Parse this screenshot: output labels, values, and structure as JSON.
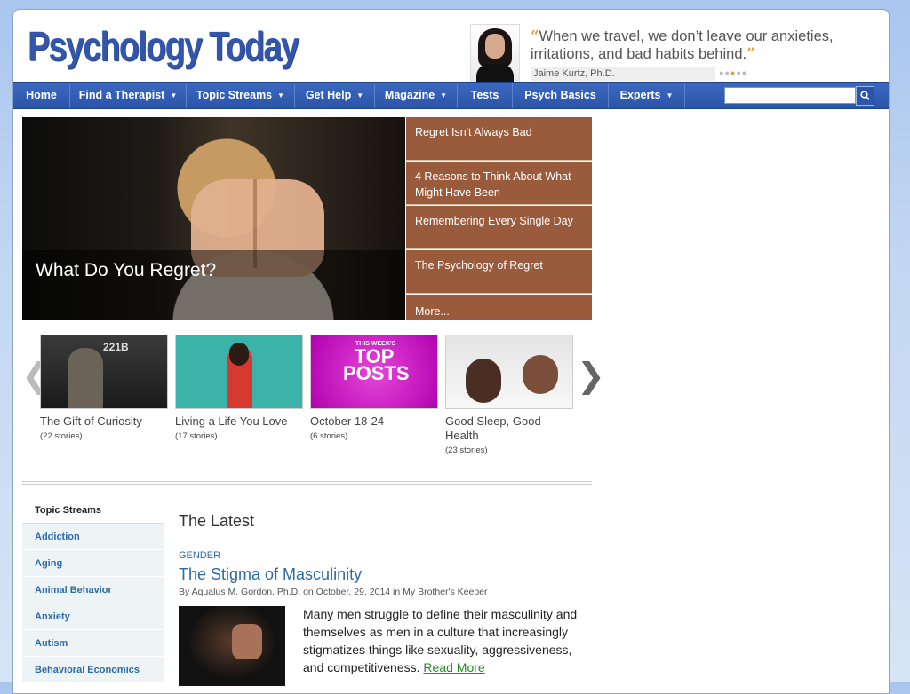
{
  "header": {
    "logo_text": "Psychology Today",
    "quote_text": "When we travel, we don’t leave our anxieties, irritations, and bad habits behind.",
    "quote_open": "“",
    "quote_close": "”",
    "quote_author": "Jaime Kurtz, Ph.D."
  },
  "nav": {
    "items": [
      {
        "label": "Home"
      },
      {
        "label": "Find a Therapist"
      },
      {
        "label": "Topic Streams"
      },
      {
        "label": "Get Help"
      },
      {
        "label": "Magazine"
      },
      {
        "label": "Tests"
      },
      {
        "label": "Psych Basics"
      },
      {
        "label": "Experts"
      }
    ],
    "search_placeholder": "",
    "caret": "▼",
    "search_icon": "search-icon"
  },
  "hero": {
    "title": "What Do You Regret?",
    "links": [
      {
        "label": "Regret Isn't Always Bad"
      },
      {
        "label": "4 Reasons to Think About What Might Have Been"
      },
      {
        "label": "Remembering Every Single Day"
      },
      {
        "label": "The Psychology of Regret"
      },
      {
        "label": "More..."
      }
    ]
  },
  "carousel": {
    "prev": "❮",
    "next": "❯",
    "cards": [
      {
        "title": "The Gift of Curiosity",
        "count": "(22 stories)",
        "thumb_text": "221B"
      },
      {
        "title": "Living a Life You Love",
        "count": "(17 stories)"
      },
      {
        "title": "October 18-24",
        "count": "(6 stories)",
        "thumb_small": "THIS WEEK'S",
        "thumb_big": "TOP POSTS"
      },
      {
        "title": "Good Sleep, Good Health",
        "count": "(23 stories)"
      }
    ]
  },
  "sidebar": {
    "heading": "Topic Streams",
    "items": [
      {
        "label": "Addiction"
      },
      {
        "label": "Aging"
      },
      {
        "label": "Animal Behavior"
      },
      {
        "label": "Anxiety"
      },
      {
        "label": "Autism"
      },
      {
        "label": "Behavioral Economics"
      }
    ]
  },
  "latest": {
    "heading": "The Latest",
    "category": "GENDER",
    "title": "The Stigma of Masculinity",
    "byline": "By Aqualus M. Gordon, Ph.D. on October, 29, 2014 in My Brother's Keeper",
    "excerpt": "Many men struggle to define their masculinity and themselves as men in a culture that increasingly stigmatizes things like sexuality, aggressiveness, and competitiveness.",
    "read_more": "Read More"
  }
}
